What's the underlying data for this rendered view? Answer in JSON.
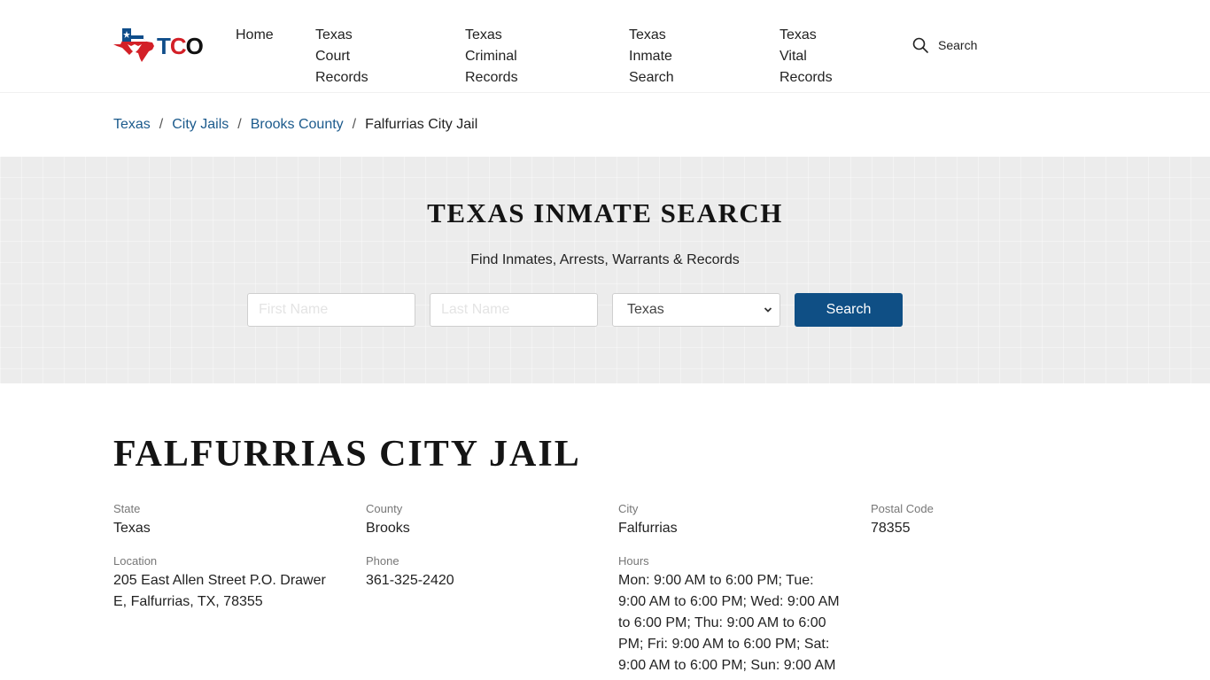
{
  "header": {
    "logo": {
      "letters": [
        "T",
        "C",
        "O"
      ],
      "colors": {
        "t": "#0f4d8a",
        "c": "#d32027",
        "o": "#111111"
      }
    },
    "nav": [
      {
        "label": "Home"
      },
      {
        "label": "Texas Court\nRecords"
      },
      {
        "label": "Texas Criminal\nRecords"
      },
      {
        "label": "Texas Inmate\nSearch"
      },
      {
        "label": "Texas Vital\nRecords"
      }
    ],
    "search": {
      "icon": "search-icon",
      "label": "Search"
    }
  },
  "breadcrumb": {
    "items": [
      {
        "label": "Texas"
      },
      {
        "label": "City Jails"
      },
      {
        "label": "Brooks County"
      }
    ],
    "separator": "/",
    "current": "Falfurrias City Jail"
  },
  "search_band": {
    "title": "TEXAS INMATE SEARCH",
    "subtitle": "Find Inmates, Arrests, Warrants & Records",
    "first_name_placeholder": "First Name",
    "last_name_placeholder": "Last Name",
    "state_selected": "Texas",
    "button_label": "Search",
    "accent": "#0f4f85"
  },
  "main": {
    "title": "FALFURRIAS CITY JAIL",
    "fields": {
      "state": {
        "label": "State",
        "value": "Texas"
      },
      "county": {
        "label": "County",
        "value": "Brooks"
      },
      "city": {
        "label": "City",
        "value": "Falfurrias"
      },
      "postal": {
        "label": "Postal Code",
        "value": "78355"
      },
      "location": {
        "label": "Location",
        "value": "205 East Allen Street P.O. Drawer E, Falfurrias, TX, 78355"
      },
      "phone": {
        "label": "Phone",
        "value": "361-325-2420"
      },
      "hours": {
        "label": "Hours",
        "value": "Mon: 9:00 AM to 6:00 PM; Tue: 9:00 AM to 6:00 PM; Wed: 9:00 AM to 6:00 PM; Thu: 9:00 AM to 6:00 PM; Fri: 9:00 AM to 6:00 PM; Sat: 9:00 AM to 6:00 PM; Sun: 9:00 AM"
      }
    }
  }
}
